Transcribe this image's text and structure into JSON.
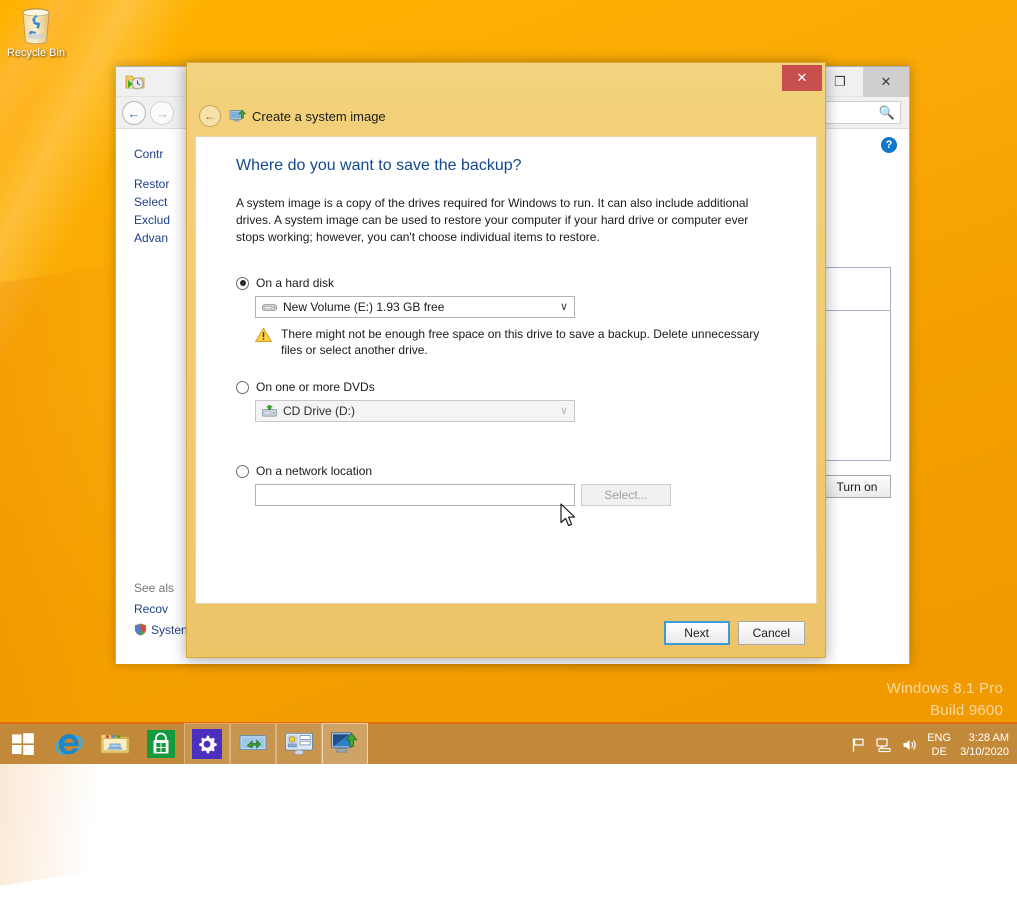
{
  "desktop": {
    "recycle_bin_label": "Recycle Bin",
    "recycle_bin_icon": "recycle-bin-icon",
    "watermark_line1": "Windows 8.1 Pro",
    "watermark_line2": "Build 9600"
  },
  "background_window": {
    "app_icon": "file-history-icon",
    "title": "",
    "window_buttons": {
      "maximize": "❐",
      "close": "✕"
    },
    "nav": {
      "back": "←",
      "forward": "→"
    },
    "search_icon": "search-icon",
    "help_icon": "help-icon",
    "breadcrumb": "Contr",
    "left_links": [
      "Restor",
      "Select",
      "Exclud",
      "Advan"
    ],
    "see_also_title": "See als",
    "see_also_links": [
      "Recov",
      "Systen"
    ],
    "shield_icon": "shield-icon",
    "turn_on_label": "Turn on"
  },
  "dialog": {
    "close_label": "✕",
    "back_label": "←",
    "app_icon": "system-image-icon",
    "app_title": "Create a system image",
    "heading": "Where do you want to save the backup?",
    "description": "A system image is a copy of the drives required for Windows to run. It can also include additional drives. A system image can be used to restore your computer if your hard drive or computer ever stops working; however, you can't choose individual items to restore.",
    "options": [
      {
        "id": "hard-disk",
        "label": "On a hard disk",
        "selected": true,
        "combo_value": "New Volume (E:)  1.93 GB free",
        "combo_icon": "hard-drive-icon",
        "combo_chevron": "∨",
        "combo_disabled": false,
        "warning_icon": "warning-icon",
        "warning_text": "There might not be enough free space on this drive to save a backup. Delete unnecessary files or select another drive."
      },
      {
        "id": "dvd",
        "label": "On one or more DVDs",
        "selected": false,
        "combo_value": "CD Drive (D:)",
        "combo_icon": "cd-drive-icon",
        "combo_chevron": "∨",
        "combo_disabled": true
      },
      {
        "id": "network",
        "label": "On a network location",
        "selected": false,
        "input_value": "",
        "input_placeholder": "",
        "select_button_label": "Select...",
        "select_button_disabled": true
      }
    ],
    "buttons": {
      "next": "Next",
      "cancel": "Cancel"
    },
    "colors": {
      "title_bar": "#efc967",
      "close_button": "#c7504f",
      "heading_text": "#13498e",
      "focus_border": "#3c9ad6"
    }
  },
  "taskbar": {
    "start_icon": "windows-start-icon",
    "items": [
      {
        "name": "internet-explorer-icon",
        "label": "Internet Explorer"
      },
      {
        "name": "file-explorer-icon",
        "label": "File Explorer"
      },
      {
        "name": "store-icon",
        "label": "Store"
      },
      {
        "name": "settings-icon",
        "label": "Settings"
      },
      {
        "name": "file-history-icon",
        "label": "File History"
      },
      {
        "name": "control-panel-icon",
        "label": "Control Panel"
      },
      {
        "name": "system-image-backup-icon",
        "label": "Create a system image"
      }
    ],
    "tray": {
      "action_center_icon": "flag-icon",
      "network_icon": "network-icon",
      "volume_icon": "speaker-icon",
      "language_line1": "ENG",
      "language_line2": "DE",
      "time": "3:28 AM",
      "date": "3/10/2020"
    }
  }
}
